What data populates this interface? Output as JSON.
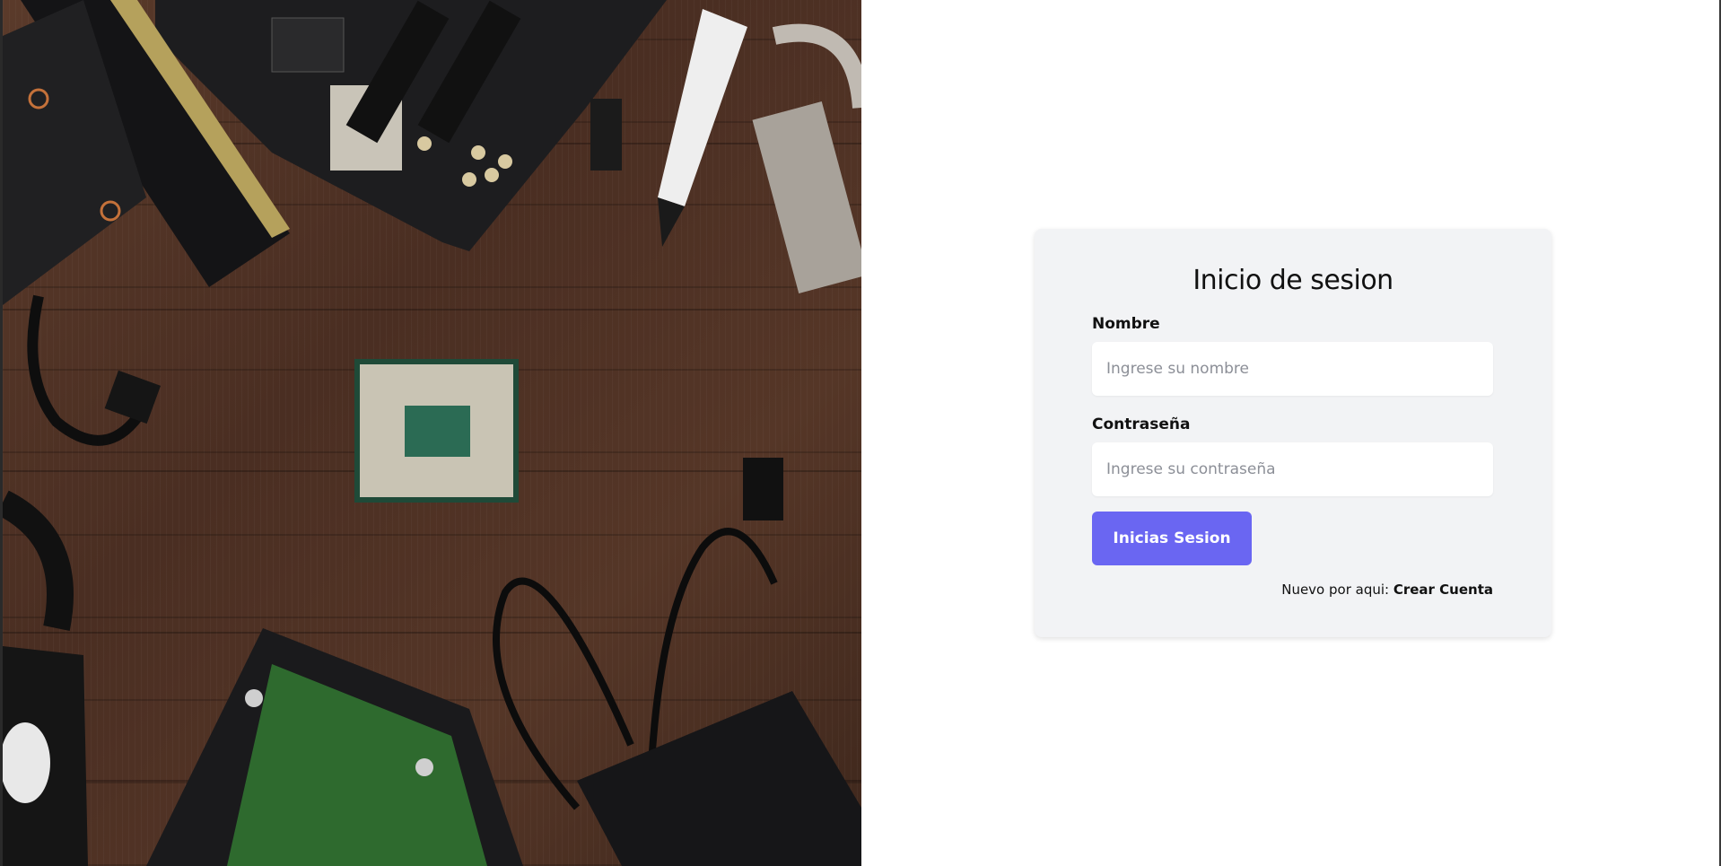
{
  "hero_image": {
    "icon": "computer-hardware-photo",
    "colors": {
      "wood": "#4a2e22",
      "pcb_dark": "#1c1c1c",
      "pcb_green": "#2e5a2a"
    }
  },
  "login": {
    "title": "Inicio de sesion",
    "name_label": "Nombre",
    "name_placeholder": "Ingrese su nombre",
    "name_value": "",
    "password_label": "Contraseña",
    "password_placeholder": "Ingrese su contraseña",
    "password_value": "",
    "submit_label": "Inicias Sesion",
    "signup_prompt": "Nuevo por aqui: ",
    "signup_link": "Crear Cuenta",
    "colors": {
      "card_bg": "#f2f3f5",
      "button_bg": "#6a66f2",
      "button_text": "#ffffff"
    }
  }
}
